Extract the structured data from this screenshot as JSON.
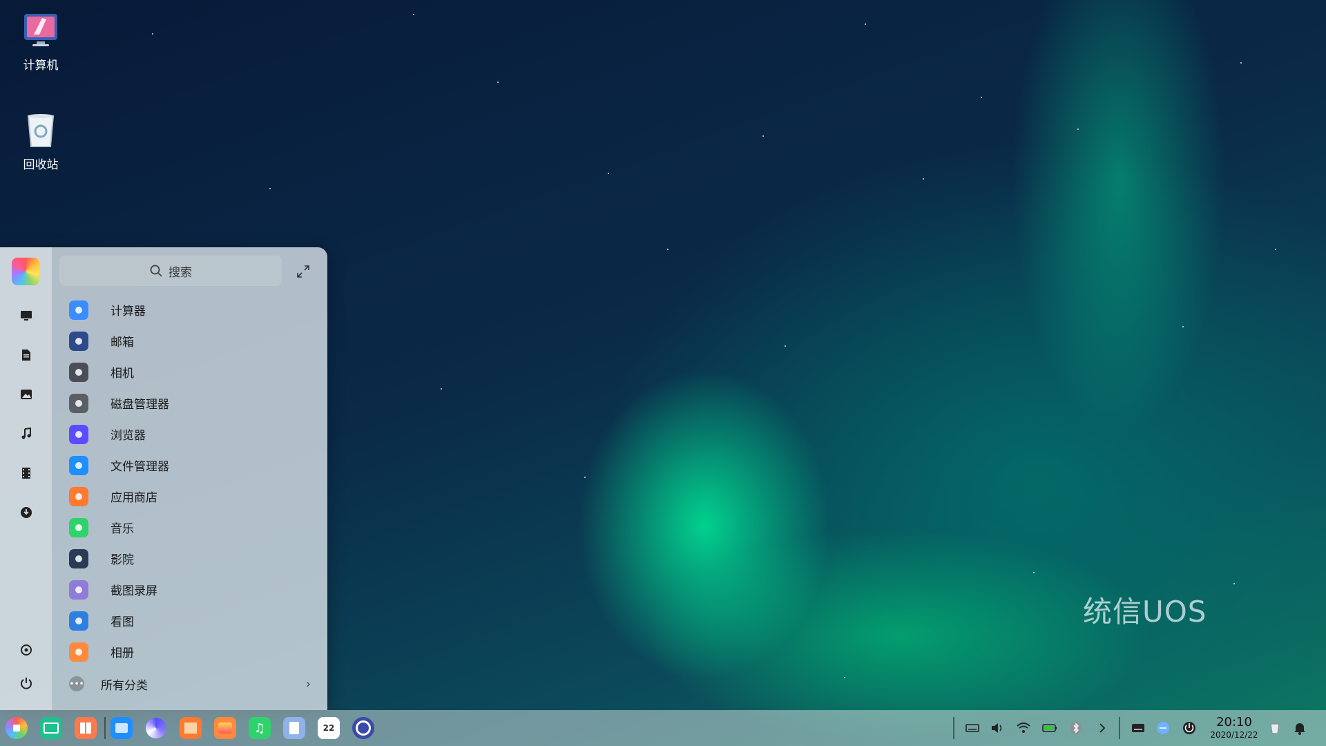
{
  "desktop": {
    "icons": [
      {
        "label": "计算机"
      },
      {
        "label": "回收站"
      }
    ],
    "watermark": "统信UOS"
  },
  "launcher": {
    "search_placeholder": "搜索",
    "apps": [
      {
        "label": "计算器",
        "icon": "calculator-icon",
        "color": "#3a8dff"
      },
      {
        "label": "邮箱",
        "icon": "mail-icon",
        "color": "#2e4a8a"
      },
      {
        "label": "相机",
        "icon": "camera-icon",
        "color": "#4a4f57"
      },
      {
        "label": "磁盘管理器",
        "icon": "disk-manager-icon",
        "color": "#5a5f66"
      },
      {
        "label": "浏览器",
        "icon": "browser-icon",
        "color": "#5b4dff"
      },
      {
        "label": "文件管理器",
        "icon": "file-manager-icon",
        "color": "#1f8fff"
      },
      {
        "label": "应用商店",
        "icon": "app-store-icon",
        "color": "#ff7a2f"
      },
      {
        "label": "音乐",
        "icon": "music-icon",
        "color": "#2fd36b"
      },
      {
        "label": "影院",
        "icon": "movie-icon",
        "color": "#2b3a55"
      },
      {
        "label": "截图录屏",
        "icon": "screenshot-icon",
        "color": "#8f7bd8"
      },
      {
        "label": "看图",
        "icon": "image-viewer-icon",
        "color": "#2f7fe0"
      },
      {
        "label": "相册",
        "icon": "album-icon",
        "color": "#ff8a3d"
      }
    ],
    "all_categories": "所有分类"
  },
  "taskbar": {
    "time": "20:10",
    "date": "2020/12/22"
  }
}
